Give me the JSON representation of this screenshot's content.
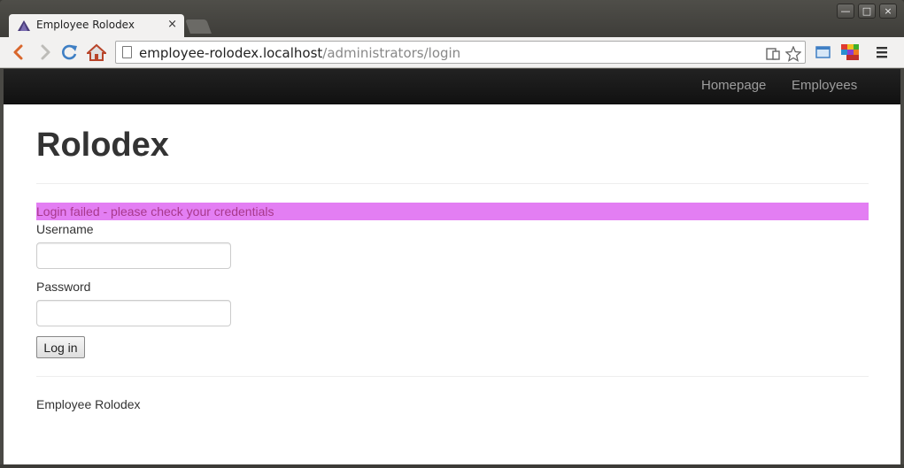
{
  "browser": {
    "tab_title": "Employee Rolodex",
    "tab_close": "×",
    "url_host": "employee-rolodex.localhost",
    "url_path": "/administrators/login",
    "window_buttons": [
      "—",
      "□",
      "×"
    ]
  },
  "navbar": {
    "links": [
      "Homepage",
      "Employees"
    ]
  },
  "main": {
    "heading": "Rolodex",
    "alert": "Login failed - please check your credentials",
    "username_label": "Username",
    "username_value": "",
    "password_label": "Password",
    "password_value": "",
    "login_button": "Log in",
    "footer": "Employee Rolodex"
  },
  "colors": {
    "alert_bg": "#e37ef3",
    "alert_text": "#a8388c",
    "navbar_bg": "#1b1b1b"
  }
}
